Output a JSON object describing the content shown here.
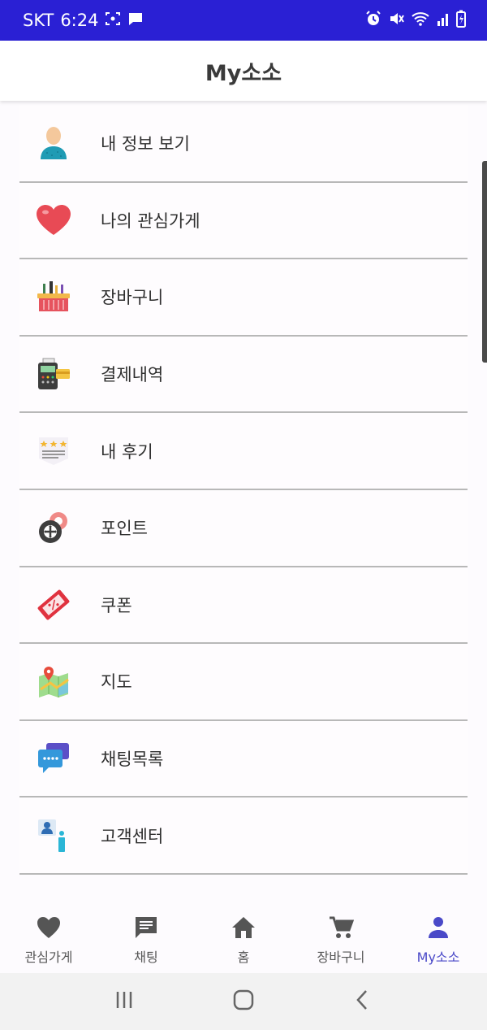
{
  "status_bar": {
    "carrier": "SKT",
    "time": "6:24"
  },
  "header": {
    "title": "My소소"
  },
  "menu": {
    "items": [
      {
        "label": "내 정보 보기",
        "icon": "person-icon"
      },
      {
        "label": "나의 관심가게",
        "icon": "heart-icon"
      },
      {
        "label": "장바구니",
        "icon": "basket-icon"
      },
      {
        "label": "결제내역",
        "icon": "payment-terminal-icon"
      },
      {
        "label": "내 후기",
        "icon": "review-stars-icon"
      },
      {
        "label": "포인트",
        "icon": "points-gear-icon"
      },
      {
        "label": "쿠폰",
        "icon": "coupon-ticket-icon"
      },
      {
        "label": "지도",
        "icon": "map-icon"
      },
      {
        "label": "채팅목록",
        "icon": "chat-bubbles-icon"
      },
      {
        "label": "고객센터",
        "icon": "customer-center-icon"
      }
    ]
  },
  "bottom_nav": {
    "items": [
      {
        "label": "관심가게",
        "icon": "heart-icon"
      },
      {
        "label": "채팅",
        "icon": "chat-icon"
      },
      {
        "label": "홈",
        "icon": "home-icon"
      },
      {
        "label": "장바구니",
        "icon": "cart-icon"
      },
      {
        "label": "My소소",
        "icon": "person-icon"
      }
    ],
    "active_index": 4
  },
  "colors": {
    "status_bar": "#2a20d4",
    "active_nav": "#4a49c8",
    "inactive_nav": "#555555"
  }
}
